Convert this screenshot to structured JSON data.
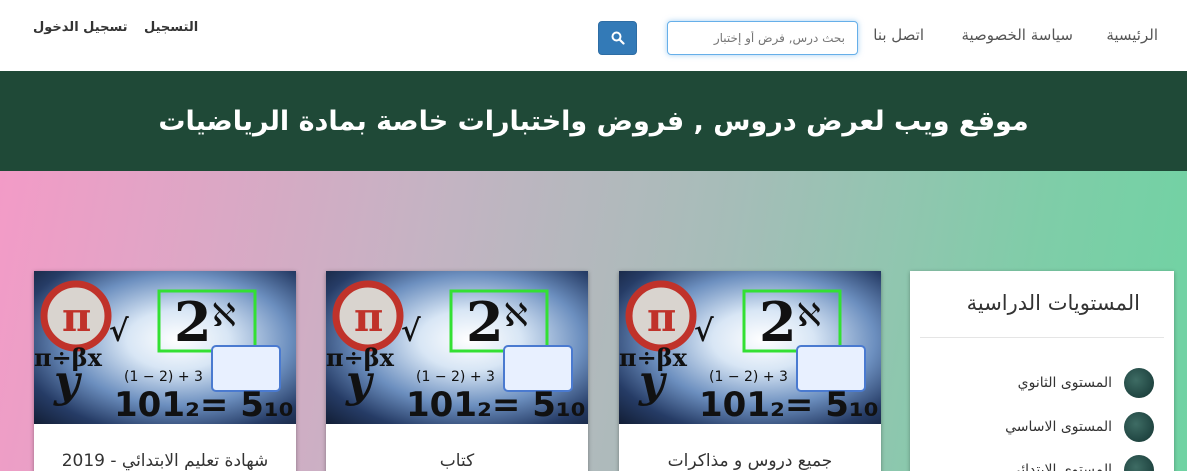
{
  "navbar": {
    "links": [
      "الرئيسية",
      "سياسة الخصوصية",
      "اتصل بنا"
    ],
    "search_placeholder": "بحث درس, فرض أو إختبار",
    "register": "التسجيل",
    "login": "تسجيل الدخول",
    "search_icon": "search-icon"
  },
  "banner": {
    "title": "موقع ويب لعرض دروس , فروض واختبارات خاصة بمادة الرياضيات"
  },
  "sidebar": {
    "title": "المستويات الدراسية",
    "items": [
      "المستوى الثانوي",
      "المستوى الاساسي",
      "المستوى الابتدائي"
    ]
  },
  "cards": [
    {
      "title": "جميع دروس و مذاكرات"
    },
    {
      "title": "كتاب"
    },
    {
      "title": "شهادة تعليم الابتدائي - 2019"
    }
  ],
  "colors": {
    "banner": "#1f4937",
    "search_button": "#337ab7",
    "gradient_left": "#f39bc7",
    "gradient_right": "#6fd3a3"
  }
}
